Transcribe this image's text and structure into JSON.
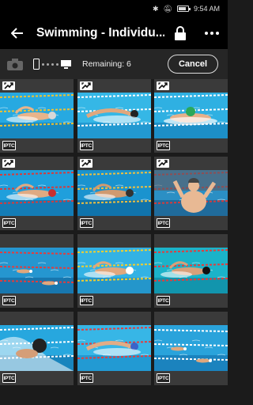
{
  "status_bar": {
    "time": "9:54 AM"
  },
  "app_bar": {
    "title": "Swimming - Individu..."
  },
  "toolbar": {
    "remaining": "Remaining: 6",
    "cancel_label": "Cancel"
  },
  "colors": {
    "background": "#1b1b1b",
    "bar": "#000000",
    "toolbar": "#262626",
    "pool": "#1e9fd6"
  },
  "photos": [
    {
      "sync": true,
      "iptc": "IPTC",
      "scene": "freestyle-side"
    },
    {
      "sync": true,
      "iptc": "IPTC",
      "scene": "butterfly-side"
    },
    {
      "sync": true,
      "iptc": "IPTC",
      "scene": "butterfly-front"
    },
    {
      "sync": true,
      "iptc": "IPTC",
      "scene": "freestyle-red-cap"
    },
    {
      "sync": true,
      "iptc": "IPTC",
      "scene": "freestyle-dark"
    },
    {
      "sync": true,
      "iptc": "IPTC",
      "scene": "celebrating-swimmer"
    },
    {
      "sync": false,
      "iptc": "IPTC",
      "scene": "lanes-wide"
    },
    {
      "sync": false,
      "iptc": "IPTC",
      "scene": "lanes-yellow"
    },
    {
      "sync": false,
      "iptc": "IPTC",
      "scene": "freestyle-turquoise"
    },
    {
      "sync": false,
      "iptc": "IPTC",
      "scene": "splash-closeup"
    },
    {
      "sync": false,
      "iptc": "IPTC",
      "scene": "backstroke-red"
    },
    {
      "sync": false,
      "iptc": "IPTC",
      "scene": "lanes-overhead"
    }
  ]
}
